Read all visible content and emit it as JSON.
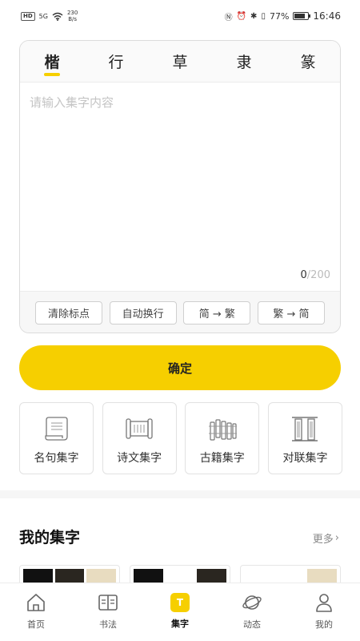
{
  "status_bar": {
    "hd": "HD",
    "network": "5G",
    "speed_value": "230",
    "speed_unit": "B/s",
    "battery_percent": "77%",
    "battery_level": 0.77,
    "time": "16:46",
    "icons": [
      "nfc-icon",
      "alarm-icon",
      "bluetooth-icon",
      "vibrate-icon"
    ]
  },
  "tabs": [
    {
      "label": "楷",
      "active": true
    },
    {
      "label": "行",
      "active": false
    },
    {
      "label": "草",
      "active": false
    },
    {
      "label": "隶",
      "active": false
    },
    {
      "label": "篆",
      "active": false
    }
  ],
  "input": {
    "placeholder": "请输入集字内容",
    "count": "0",
    "max": "/200"
  },
  "tools": [
    "清除标点",
    "自动换行",
    "简 → 繁",
    "繁 → 简"
  ],
  "confirm_label": "确定",
  "categories": [
    {
      "label": "名句集字",
      "icon": "scroll-icon"
    },
    {
      "label": "诗文集字",
      "icon": "open-scroll-icon"
    },
    {
      "label": "古籍集字",
      "icon": "bamboo-slips-icon"
    },
    {
      "label": "对联集字",
      "icon": "couplet-icon"
    }
  ],
  "my_collection": {
    "title": "我的集字",
    "more": "更多"
  },
  "nav": [
    {
      "label": "首页",
      "icon": "home-icon"
    },
    {
      "label": "书法",
      "icon": "book-icon"
    },
    {
      "label": "集字",
      "icon": "collect-icon",
      "active": true,
      "badge": "T"
    },
    {
      "label": "动态",
      "icon": "planet-icon"
    },
    {
      "label": "我的",
      "icon": "profile-icon"
    }
  ],
  "colors": {
    "accent": "#f6cf00"
  }
}
